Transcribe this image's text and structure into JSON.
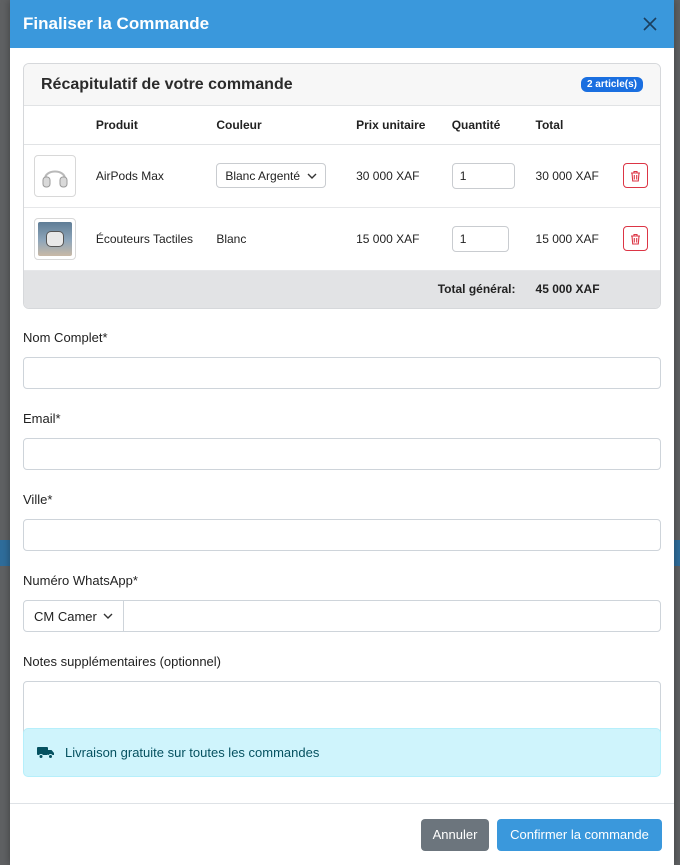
{
  "modal": {
    "title": "Finaliser la Commande",
    "close_label": "×"
  },
  "summary": {
    "title": "Récapitulatif de votre commande",
    "badge": "2 article(s)",
    "columns": [
      "Produit",
      "Couleur",
      "Prix unitaire",
      "Quantité",
      "Total"
    ],
    "items": [
      {
        "product": "AirPods Max",
        "color": "Blanc Argenté",
        "color_is_select": true,
        "unit_price": "30 000 XAF",
        "quantity": "1",
        "total": "30 000 XAF",
        "thumb_icon": "headphones-icon"
      },
      {
        "product": "Écouteurs Tactiles",
        "color": "Blanc",
        "color_is_select": false,
        "unit_price": "15 000 XAF",
        "quantity": "1",
        "total": "15 000 XAF",
        "thumb_icon": "earbuds-image"
      }
    ],
    "grand_total_label": "Total général:",
    "grand_total_value": "45 000 XAF"
  },
  "form": {
    "full_name_label": "Nom Complet*",
    "full_name_value": "",
    "email_label": "Email*",
    "email_value": "",
    "city_label": "Ville*",
    "city_value": "",
    "whatsapp_label": "Numéro WhatsApp*",
    "country_selected": "CM Camer",
    "whatsapp_value": "",
    "notes_label": "Notes supplémentaires (optionnel)",
    "notes_value": ""
  },
  "alert": {
    "text": "Livraison gratuite sur toutes les commandes",
    "icon": "truck-icon"
  },
  "footer": {
    "cancel_label": "Annuler",
    "confirm_label": "Confirmer la commande"
  },
  "colors": {
    "primary": "#3a98dc",
    "danger": "#dc3545",
    "secondary": "#6c757d",
    "info_bg": "#cff4fc",
    "badge": "#1a6fe0"
  }
}
